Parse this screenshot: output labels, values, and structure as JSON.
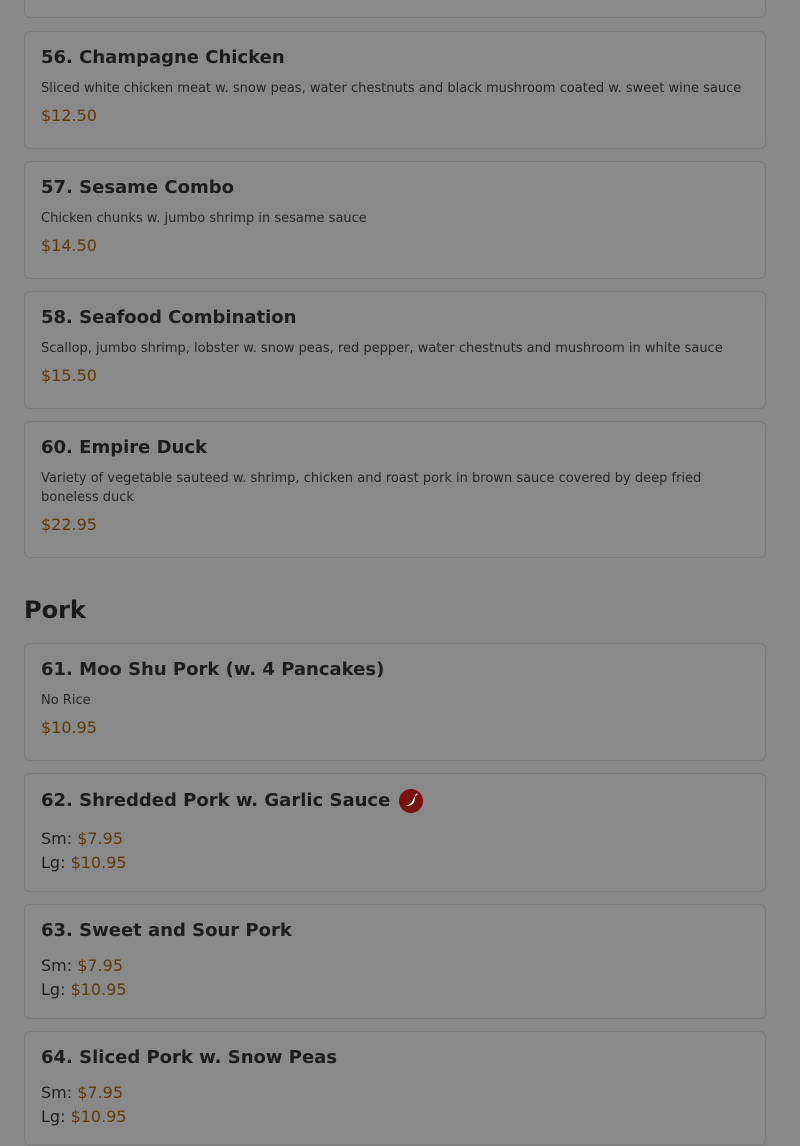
{
  "items": [
    {
      "title": "56. Champagne Chicken",
      "desc": "Sliced white chicken meat w. snow peas, water chestnuts and black mushroom coated w. sweet wine sauce",
      "price": "$12.50"
    },
    {
      "title": "57. Sesame Combo",
      "desc": "Chicken chunks w. jumbo shrimp in sesame sauce",
      "price": "$14.50"
    },
    {
      "title": "58. Seafood Combination",
      "desc": "Scallop, jumbo shrimp, lobster w. snow peas, red pepper, water chestnuts and mushroom in white sauce",
      "price": "$15.50"
    },
    {
      "title": "60. Empire Duck",
      "desc": "Variety of vegetable sauteed w. shrimp, chicken and roast pork in brown sauce covered by deep fried boneless duck",
      "price": "$22.95"
    }
  ],
  "pork_section": {
    "title": "Pork",
    "items": [
      {
        "title": "61. Moo Shu Pork (w. 4 Pancakes)",
        "desc": "No Rice",
        "price": "$10.95"
      },
      {
        "title": "62. Shredded Pork w. Garlic Sauce",
        "spicy_icon": "chili-pepper-icon",
        "sm_label": "Sm:",
        "sm_price": "$7.95",
        "lg_label": "Lg:",
        "lg_price": "$10.95"
      },
      {
        "title": "63. Sweet and Sour Pork",
        "sm_label": "Sm:",
        "sm_price": "$7.95",
        "lg_label": "Lg:",
        "lg_price": "$10.95"
      },
      {
        "title": "64. Sliced Pork w. Snow Peas",
        "sm_label": "Sm:",
        "sm_price": "$7.95",
        "lg_label": "Lg:",
        "lg_price": "$10.95"
      }
    ]
  }
}
